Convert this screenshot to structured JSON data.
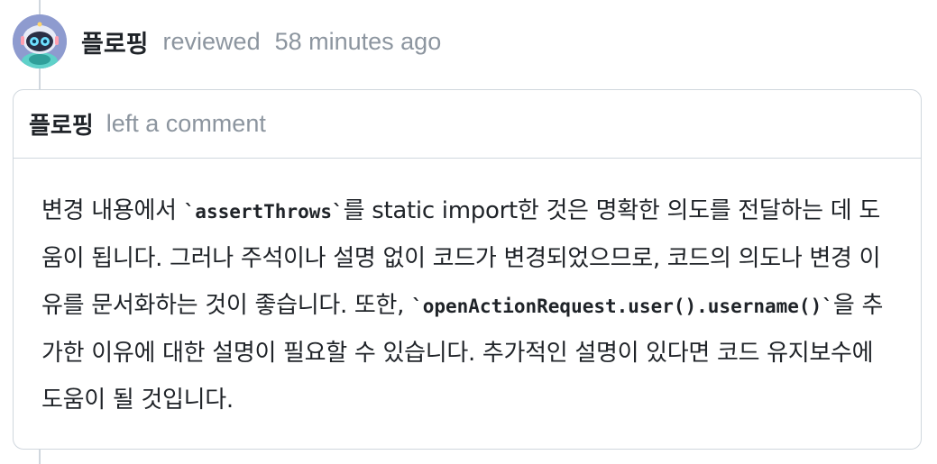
{
  "review": {
    "reviewer": "플로핑",
    "action": "reviewed",
    "time": "58 minutes ago"
  },
  "comment": {
    "author": "플로핑",
    "action": "left a comment",
    "body": {
      "seg1": "변경 내용에서 ",
      "code1": "`assertThrows`",
      "seg2": "를 static import한 것은 명확한 의도를 전달하는 데 도움이 됩니다. 그러나 주석이나 설명 없이 코드가 변경되었으므로, 코드의 의도나 변경 이유를 문서화하는 것이 좋습니다. 또한, ",
      "code2": "`openActionRequest.user().username()`",
      "seg3": "을 추가한 이유에 대한 설명이 필요할 수 있습니다. 추가적인 설명이 있다면 코드 유지보수에 도움이 될 것입니다."
    }
  },
  "colors": {
    "border": "#d0d7de",
    "muted_text": "#8c959f",
    "text": "#1f2328"
  }
}
